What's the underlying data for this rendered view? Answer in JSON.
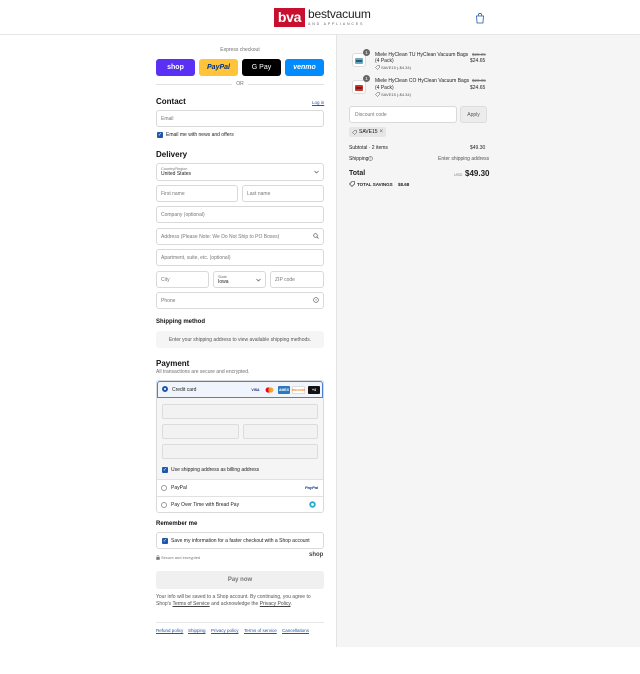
{
  "header": {
    "logo_mark": "bva",
    "logo_name": "bestvacuum",
    "logo_tagline": "AND APPLIANCES"
  },
  "express": {
    "title": "Express checkout",
    "buttons": [
      {
        "label": "shop",
        "color": "#5a31f4"
      },
      {
        "label": "PayPal",
        "color": "#ffc439"
      },
      {
        "label": "G Pay",
        "color": "#000000"
      },
      {
        "label": "venmo",
        "color": "#008cff"
      }
    ],
    "or": "OR"
  },
  "contact": {
    "heading": "Contact",
    "login_link": "Log in",
    "email_placeholder": "Email",
    "newsletter_label": "Email me with news and offers"
  },
  "delivery": {
    "heading": "Delivery",
    "country_label": "Country/Region",
    "country_value": "United States",
    "first_name": "First name",
    "last_name": "Last name",
    "company": "Company (optional)",
    "address": "Address (Please Note: We Do Not Ship to PO Boxes)",
    "apartment": "Apartment, suite, etc. (optional)",
    "city": "City",
    "state_label": "State",
    "state_value": "Iowa",
    "zip": "ZIP code",
    "phone": "Phone"
  },
  "shipping_method": {
    "heading": "Shipping method",
    "message": "Enter your shipping address to view available shipping methods."
  },
  "payment": {
    "heading": "Payment",
    "subtext": "All transactions are secure and encrypted.",
    "credit_card_label": "Credit card",
    "cards": [
      {
        "label": "VISA",
        "color": "#1a1f71"
      },
      {
        "label": "MC",
        "color": "#eb001b"
      },
      {
        "label": "AMEX",
        "color": "#2e77bc"
      },
      {
        "label": "DISCOVER",
        "color": "#f58220"
      },
      {
        "label": "+4",
        "color": "#111111"
      }
    ],
    "billing_label": "Use shipping address as billing address",
    "paypal_label": "PayPal",
    "paypal_badge": "PayPal",
    "bread_label": "Pay Over Time with Bread Pay"
  },
  "remember": {
    "heading": "Remember me",
    "save_label": "Save my information for a faster checkout with a Shop account",
    "secure_text": "Secure and encrypted",
    "shop_badge": "shop"
  },
  "pay_now": "Pay now",
  "legal": {
    "prefix": "Your info will be saved to a Shop account. By continuing, you agree to Shop's",
    "terms": "Terms of Service",
    "middle": "and acknowledge the",
    "privacy": "Privacy Policy",
    "suffix": "."
  },
  "footer_links": [
    "Refund policy",
    "Shipping",
    "Privacy policy",
    "Terms of service",
    "Cancellations"
  ],
  "cart": {
    "items": [
      {
        "qty": "1",
        "name_line1": "Miele HyClean TU HyClean Vacuum Bags",
        "name_line2": "(4 Pack)",
        "discount": "SAVE15 (-$4.34)",
        "old_price": "$28.95",
        "price": "$24.65"
      },
      {
        "qty": "1",
        "name_line1": "Miele HyClean CO HyClean Vacuum Bags",
        "name_line2": "(4 Pack)",
        "discount": "SAVE15 (-$4.34)",
        "old_price": "$28.95",
        "price": "$24.65"
      }
    ],
    "discount_placeholder": "Discount code",
    "apply_label": "Apply",
    "applied_code": "SAVE15",
    "subtotal_label": "Subtotal · 2 items",
    "subtotal_value": "$49.30",
    "shipping_label": "Shipping",
    "shipping_value": "Enter shipping address",
    "total_label": "Total",
    "currency": "USD",
    "total_value": "$49.30",
    "savings_label": "TOTAL SAVINGS",
    "savings_value": "$8.68"
  }
}
